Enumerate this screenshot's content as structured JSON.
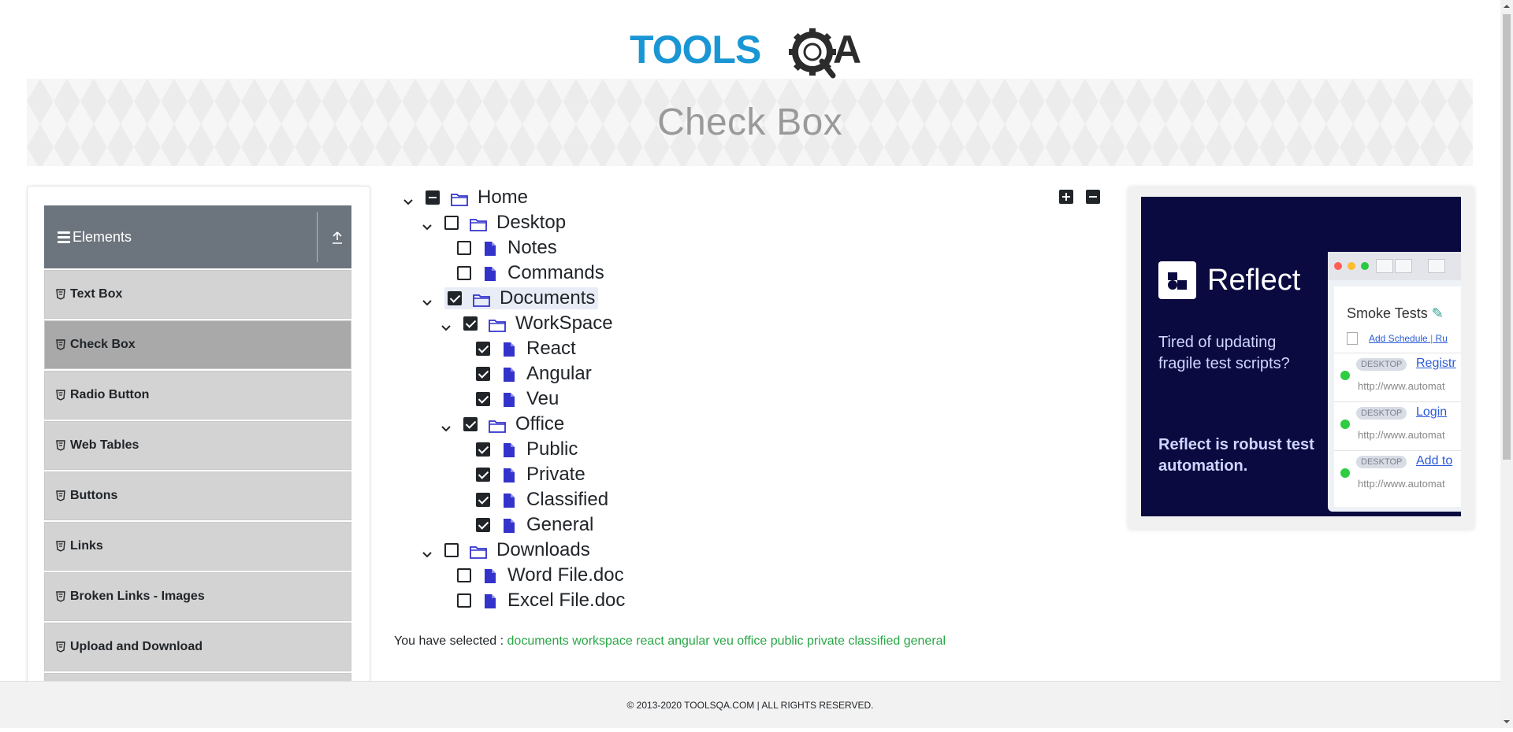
{
  "logo": {
    "text_left": "TOOLS",
    "text_right": "QA",
    "brand_blue": "#1a96d4",
    "brand_dark": "#2c2c2c"
  },
  "banner": {
    "title": "Check Box"
  },
  "sidebar": {
    "group_title": "Elements",
    "items": [
      {
        "label": "Text Box",
        "active": false
      },
      {
        "label": "Check Box",
        "active": true
      },
      {
        "label": "Radio Button",
        "active": false
      },
      {
        "label": "Web Tables",
        "active": false
      },
      {
        "label": "Buttons",
        "active": false
      },
      {
        "label": "Links",
        "active": false
      },
      {
        "label": "Broken Links - Images",
        "active": false
      },
      {
        "label": "Upload and Download",
        "active": false
      }
    ]
  },
  "tree": {
    "home": "Home",
    "desktop": "Desktop",
    "notes": "Notes",
    "commands": "Commands",
    "documents": "Documents",
    "workspace": "WorkSpace",
    "react": "React",
    "angular": "Angular",
    "veu": "Veu",
    "office": "Office",
    "public": "Public",
    "private": "Private",
    "classified": "Classified",
    "general": "General",
    "downloads": "Downloads",
    "word_file": "Word File.doc",
    "excel_file": "Excel File.doc"
  },
  "result": {
    "prefix": "You have selected :",
    "selected": [
      "documents",
      "workspace",
      "react",
      "angular",
      "veu",
      "office",
      "public",
      "private",
      "classified",
      "general"
    ]
  },
  "ad": {
    "brand": "Reflect",
    "tagline1": "Tired of updating fragile test scripts?",
    "tagline2": "Reflect is robust test automation.",
    "window_title": "Smoke Tests",
    "add_schedule": "Add Schedule",
    "separator": "|",
    "run_partial": "Ru",
    "rows": [
      {
        "tag": "DESKTOP",
        "link": "Registr",
        "url": "http://www.automat"
      },
      {
        "tag": "DESKTOP",
        "link": "Login",
        "url": "http://www.automat"
      },
      {
        "tag": "DESKTOP",
        "link": "Add to",
        "url": "http://www.automat"
      }
    ]
  },
  "footer": {
    "text": "© 2013-2020 TOOLSQA.COM | ALL RIGHTS RESERVED."
  },
  "colors": {
    "sidebar_header": "#6c757d",
    "menu_item": "#d3d3d3",
    "menu_active": "#a9a9a9",
    "icon_blue": "#3333cc",
    "selected_green": "#28a745",
    "ad_bg": "#0b0a40"
  }
}
